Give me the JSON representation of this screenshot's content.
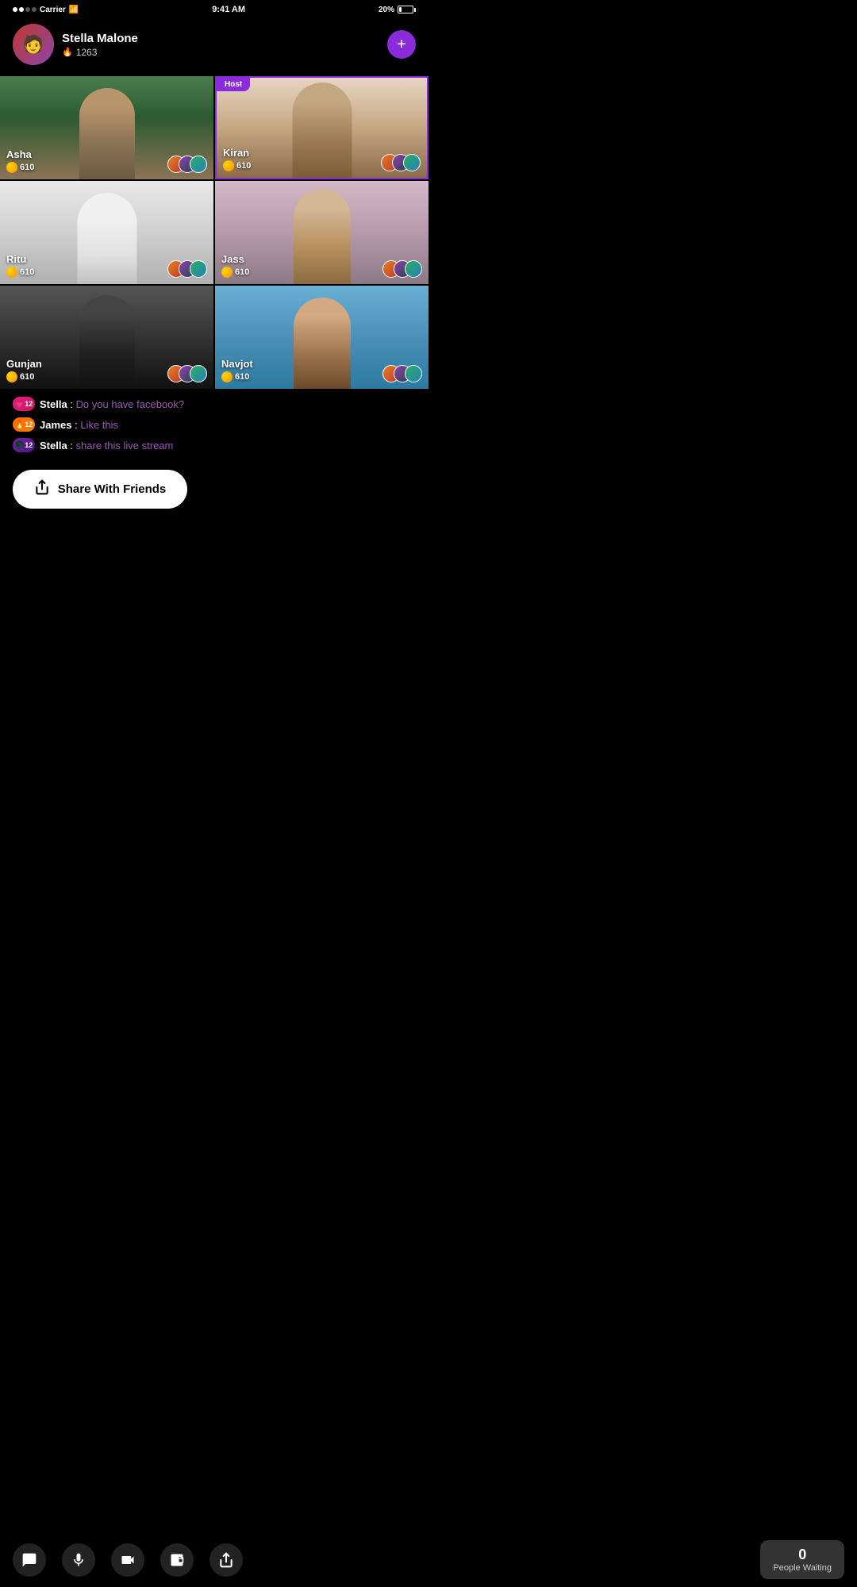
{
  "statusBar": {
    "carrier": "Carrier",
    "time": "9:41 AM",
    "battery": "20%"
  },
  "profile": {
    "name": "Stella Malone",
    "score": "1263",
    "addButton": "+"
  },
  "grid": {
    "cells": [
      {
        "id": "asha",
        "name": "Asha",
        "coins": "610",
        "isHost": false,
        "bgClass": "bg-asha"
      },
      {
        "id": "kiran",
        "name": "Kiran",
        "coins": "610",
        "isHost": true,
        "bgClass": "bg-kiran"
      },
      {
        "id": "ritu",
        "name": "Ritu",
        "coins": "610",
        "isHost": false,
        "bgClass": "bg-ritu"
      },
      {
        "id": "jass",
        "name": "Jass",
        "coins": "610",
        "isHost": false,
        "bgClass": "bg-jass"
      },
      {
        "id": "gunjan",
        "name": "Gunjan",
        "coins": "610",
        "isHost": false,
        "bgClass": "bg-gunjan"
      },
      {
        "id": "navjot",
        "name": "Navjot",
        "coins": "610",
        "isHost": false,
        "bgClass": "bg-navjot"
      }
    ],
    "hostLabel": "Host"
  },
  "chat": {
    "messages": [
      {
        "user": "Stella",
        "badge": "12",
        "badgeType": "heart",
        "text": " Do you have facebook?",
        "emoji": "💗"
      },
      {
        "user": "James",
        "badge": "12",
        "badgeType": "fire",
        "text": " Like this",
        "emoji": "🔥"
      },
      {
        "user": "Stella",
        "badge": "12",
        "badgeType": "purple",
        "text": " share this live stream",
        "emoji": "🌑"
      }
    ]
  },
  "shareButton": {
    "label": "Share With Friends",
    "icon": "↗"
  },
  "bottomBar": {
    "icons": [
      {
        "id": "chat",
        "symbol": "💬"
      },
      {
        "id": "mic",
        "symbol": "🎤"
      },
      {
        "id": "video",
        "symbol": "🎥"
      },
      {
        "id": "wallet",
        "symbol": "👛"
      },
      {
        "id": "share",
        "symbol": "↗"
      }
    ],
    "peopleWaiting": {
      "count": "0",
      "label": "People Waiting"
    }
  }
}
